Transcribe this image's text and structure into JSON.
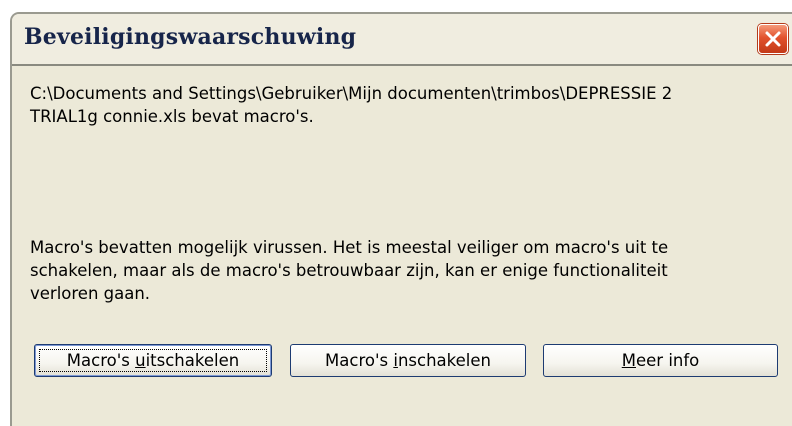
{
  "dialog": {
    "title": "Beveiligingswaarschuwing",
    "close_icon": "close-icon",
    "path_line1": "C:\\Documents and Settings\\Gebruiker\\Mijn documenten\\trimbos\\DEPRESSIE 2",
    "path_line2": "TRIAL1g connie.xls bevat macro's.",
    "warning_line1": "Macro's bevatten mogelijk virussen. Het is meestal veiliger om macro's uit te",
    "warning_line2": "schakelen, maar als de macro's betrouwbaar zijn, kan er enige functionaliteit",
    "warning_line3": "verloren gaan."
  },
  "buttons": {
    "disable": {
      "pre": "Macro's ",
      "key": "u",
      "post": "itschakelen"
    },
    "enable": {
      "pre": "Macro's ",
      "key": "i",
      "post": "nschakelen"
    },
    "info": {
      "pre": "",
      "key": "M",
      "post": "eer info"
    }
  },
  "colors": {
    "dialog_bg": "#ece9d8",
    "title_text": "#17254a",
    "close_button": "#e2522d",
    "button_border": "#1d3b72"
  }
}
